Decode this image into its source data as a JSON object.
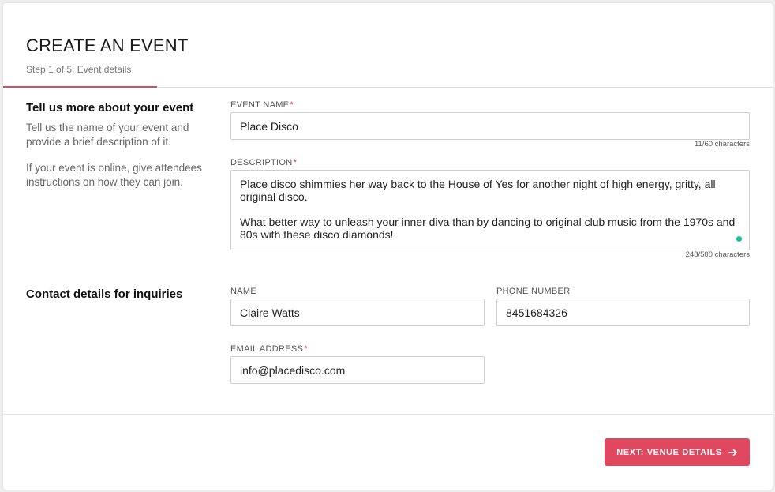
{
  "header": {
    "title": "CREATE AN EVENT",
    "step": "Step 1 of 5: Event details",
    "progress_fraction": 0.2
  },
  "event_section": {
    "heading": "Tell us more about your event",
    "paragraph1": "Tell us the name of your event and provide a brief description of it.",
    "paragraph2": "If your event is online, give attendees instructions on how they can join.",
    "event_name": {
      "label": "EVENT NAME",
      "required_mark": "*",
      "value": "Place Disco",
      "counter": "11/60 characters"
    },
    "description": {
      "label": "DESCRIPTION",
      "required_mark": "*",
      "value": "Place disco shimmies her way back to the House of Yes for another night of high energy, gritty, all original disco.\n\nWhat better way to unleash your inner diva than by dancing to original club music from the 1970s and 80s with these disco diamonds!",
      "counter": "248/500 characters"
    }
  },
  "contact_section": {
    "heading": "Contact details for inquiries",
    "name": {
      "label": "NAME",
      "value": "Claire Watts"
    },
    "phone": {
      "label": "PHONE NUMBER",
      "value": "8451684326"
    },
    "email": {
      "label": "EMAIL ADDRESS",
      "required_mark": "*",
      "value": "info@placedisco.com"
    }
  },
  "footer": {
    "next_label": "NEXT: VENUE DETAILS",
    "next_icon": "arrow-right-icon"
  },
  "colors": {
    "accent": "#e04860",
    "required": "#d0263f",
    "grammar_dot": "#15c39a"
  }
}
